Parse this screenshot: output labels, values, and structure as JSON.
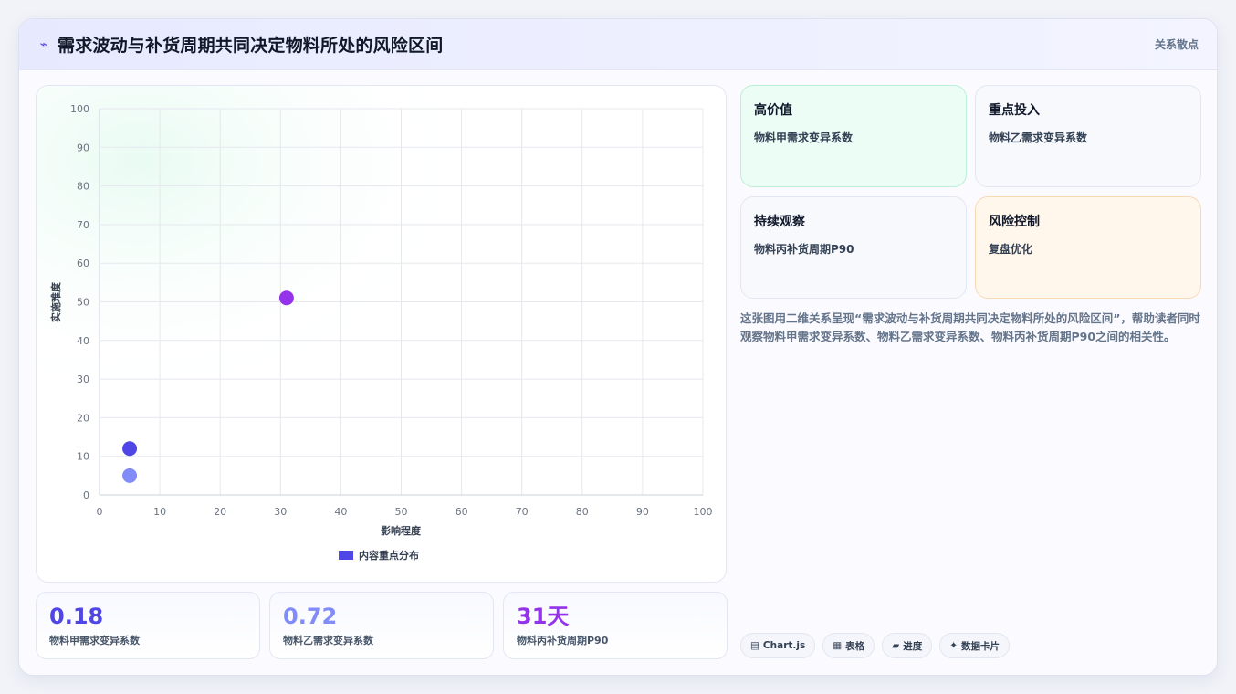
{
  "header": {
    "icon": "trend-icon",
    "title": "需求波动与补货周期共同决定物料所处的风险区间",
    "tag": "关系散点"
  },
  "chart_data": {
    "type": "scatter",
    "xlabel": "影响程度",
    "ylabel": "实施难度",
    "xlim": [
      0,
      100
    ],
    "ylim": [
      0,
      100
    ],
    "x_ticks": [
      "0",
      "10",
      "20",
      "30",
      "40",
      "50",
      "60",
      "70",
      "80",
      "90",
      "100"
    ],
    "y_ticks": [
      "0",
      "10",
      "20",
      "30",
      "40",
      "50",
      "60",
      "70",
      "80",
      "90",
      "100"
    ],
    "grid": true,
    "legend_position": "bottom",
    "series": [
      {
        "name": "内容重点分布",
        "color": "#4f46e5",
        "points": [
          {
            "x": 5,
            "y": 12,
            "color": "#4f46e5"
          },
          {
            "x": 5,
            "y": 5,
            "color": "#818cf8"
          },
          {
            "x": 31,
            "y": 51,
            "color": "#9333ea"
          }
        ]
      }
    ]
  },
  "stats": [
    {
      "value": "0.18",
      "label": "物料甲需求变异系数",
      "color": "#4f46e5"
    },
    {
      "value": "0.72",
      "label": "物料乙需求变异系数",
      "color": "#818cf8"
    },
    {
      "value": "31天",
      "label": "物料丙补货周期P90",
      "color": "#9333ea"
    }
  ],
  "quadrants": [
    {
      "title": "高价值",
      "text": "物料甲需求变异系数"
    },
    {
      "title": "重点投入",
      "text": "物料乙需求变异系数"
    },
    {
      "title": "持续观察",
      "text": "物料丙补货周期P90"
    },
    {
      "title": "风险控制",
      "text": "复盘优化"
    }
  ],
  "description": "这张图用二维关系呈现“需求波动与补货周期共同决定物料所处的风险区间”，帮助读者同时观察物料甲需求变异系数、物料乙需求变异系数、物料丙补货周期P90之间的相关性。",
  "chips": [
    {
      "icon": "chart-icon",
      "glyph": "▤",
      "label": "Chart.js"
    },
    {
      "icon": "table-icon",
      "glyph": "▦",
      "label": "表格"
    },
    {
      "icon": "progress-icon",
      "glyph": "▰",
      "label": "进度"
    },
    {
      "icon": "card-icon",
      "glyph": "✦",
      "label": "数据卡片"
    }
  ]
}
